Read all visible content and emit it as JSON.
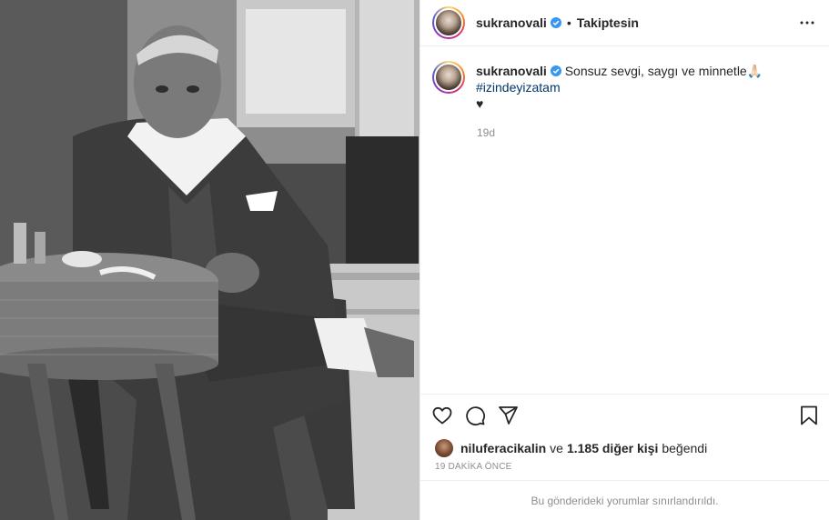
{
  "photo": {
    "alt_icon": "photo"
  },
  "header": {
    "username": "sukranovali",
    "verified_icon": "verified-badge-icon",
    "separator": "•",
    "follow_status": "Takiptesin",
    "more_icon": "more-options-icon"
  },
  "caption": {
    "username": "sukranovali",
    "text": "Sonsuz sevgi, saygı ve minnetle🙏🏻",
    "hashtag": "#izindeyizatam",
    "trailing": "♥",
    "time_ago": "19d"
  },
  "actions": {
    "like_icon": "heart-icon",
    "comment_icon": "comment-icon",
    "share_icon": "share-icon",
    "save_icon": "bookmark-icon"
  },
  "likes": {
    "liker": "niluferacikalin",
    "connector": "ve",
    "others": "1.185 diğer kişi",
    "suffix": "beğendi"
  },
  "date": "19 DAKİKA ÖNCE",
  "comments_notice": "Bu gönderideki yorumlar sınırlandırıldı.",
  "colors": {
    "text": "#262626",
    "secondary": "#8e8e8e",
    "hashtag": "#00376b",
    "verified": "#3897f0",
    "divider": "#efefef"
  }
}
